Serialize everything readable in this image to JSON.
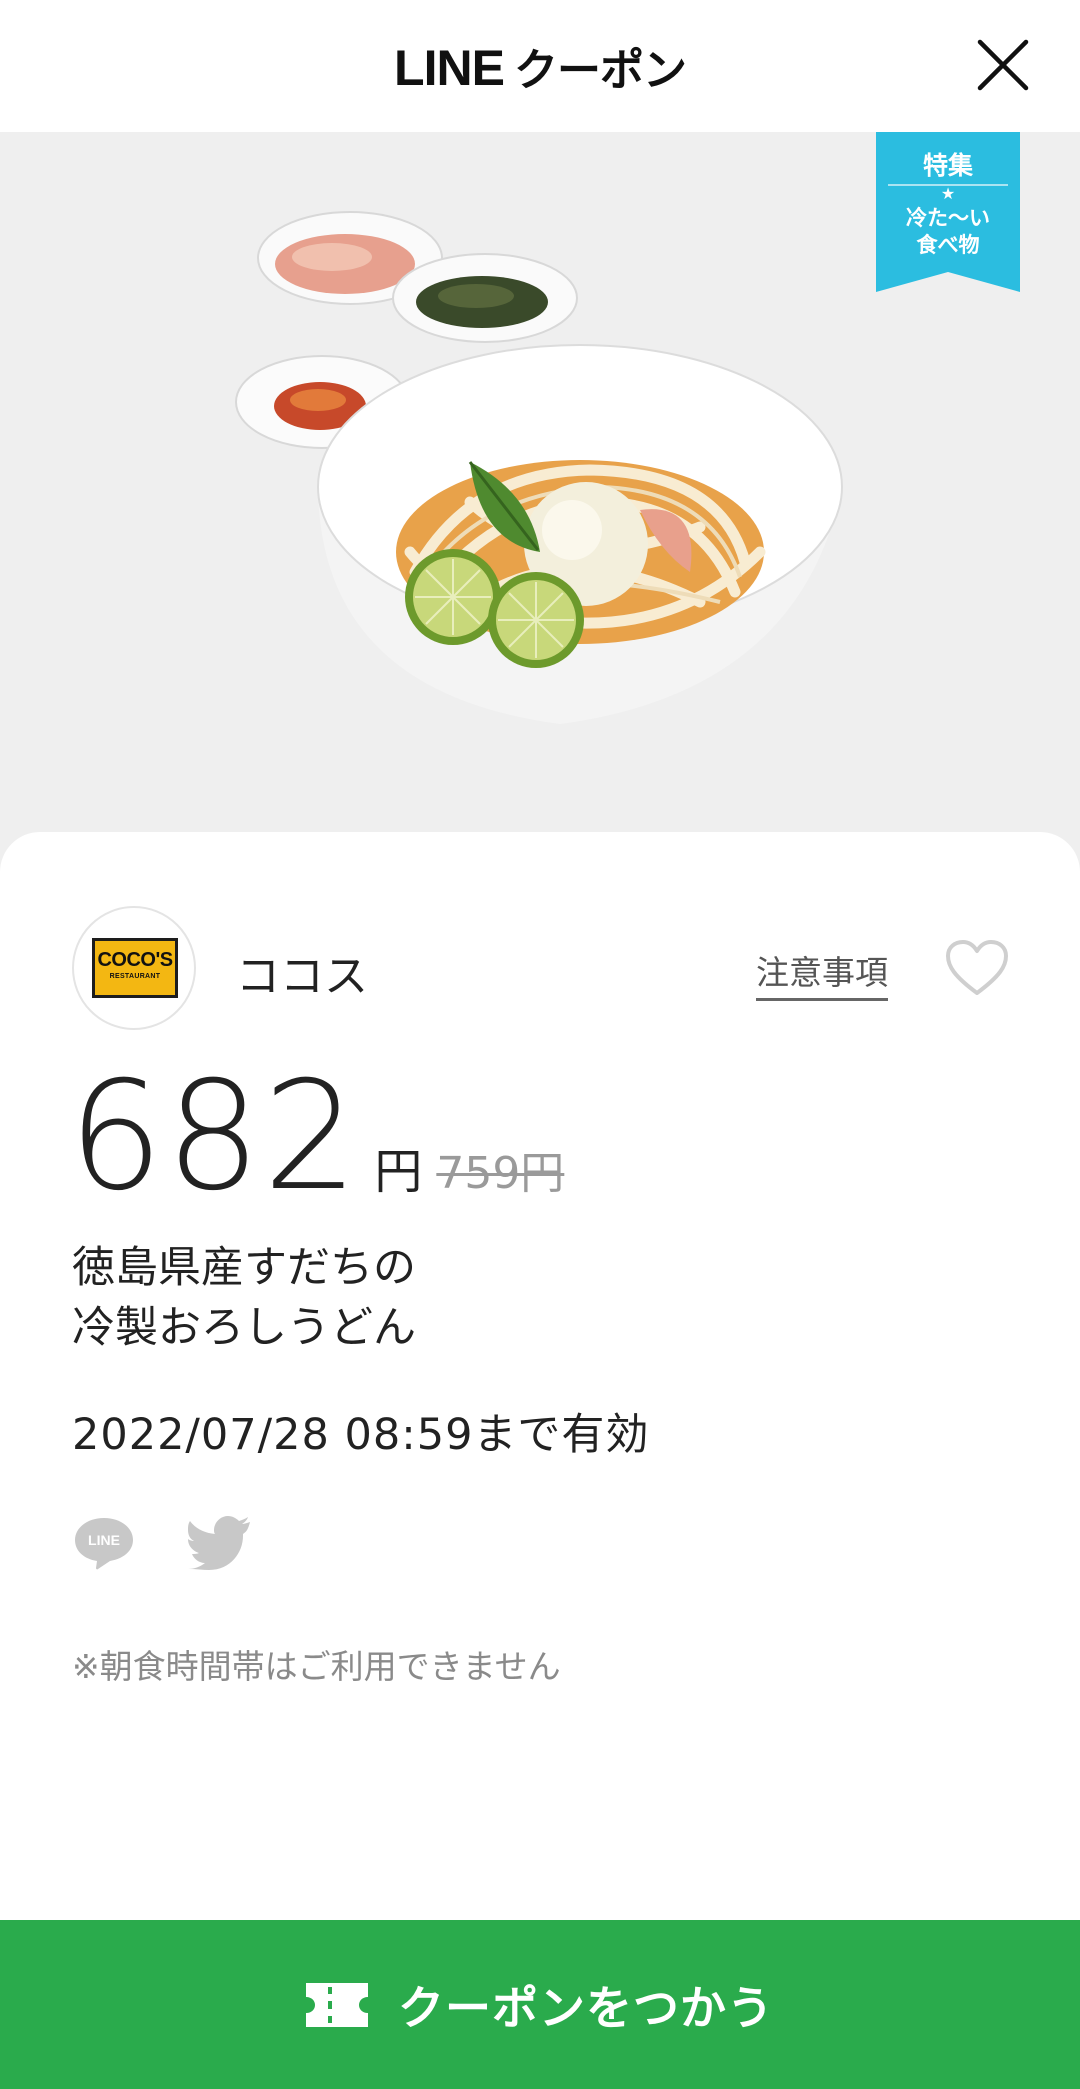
{
  "header": {
    "brand_latin": "LINE",
    "brand_jp": "クーポン",
    "close_icon": "close-icon"
  },
  "hero": {
    "image": "cold-sudachi-oroshi-udon-photo",
    "ribbon": {
      "title": "特集",
      "star": "★",
      "subtitle": "冷た〜い\n食べ物",
      "color": "#2bbde0"
    }
  },
  "store": {
    "logo_text": "COCO'S",
    "logo_subtext": "RESTAURANT",
    "name": "ココス",
    "notes_label": "注意事項",
    "favorite_icon": "heart-outline-icon"
  },
  "offer": {
    "price": "682",
    "price_unit": "円",
    "original_price": "759円",
    "product_name": "徳島県産すだちの\n冷製おろしうどん",
    "expiry": "2022/07/28  08:59まで有効"
  },
  "share": {
    "line_icon": "line-share-icon",
    "line_text": "LINE",
    "twitter_icon": "twitter-bird-icon"
  },
  "notice": "※朝食時間帯はご利用できません",
  "footer": {
    "button_label": "クーポンをつかう",
    "button_icon": "ticket-icon",
    "color": "#2aab4c"
  }
}
